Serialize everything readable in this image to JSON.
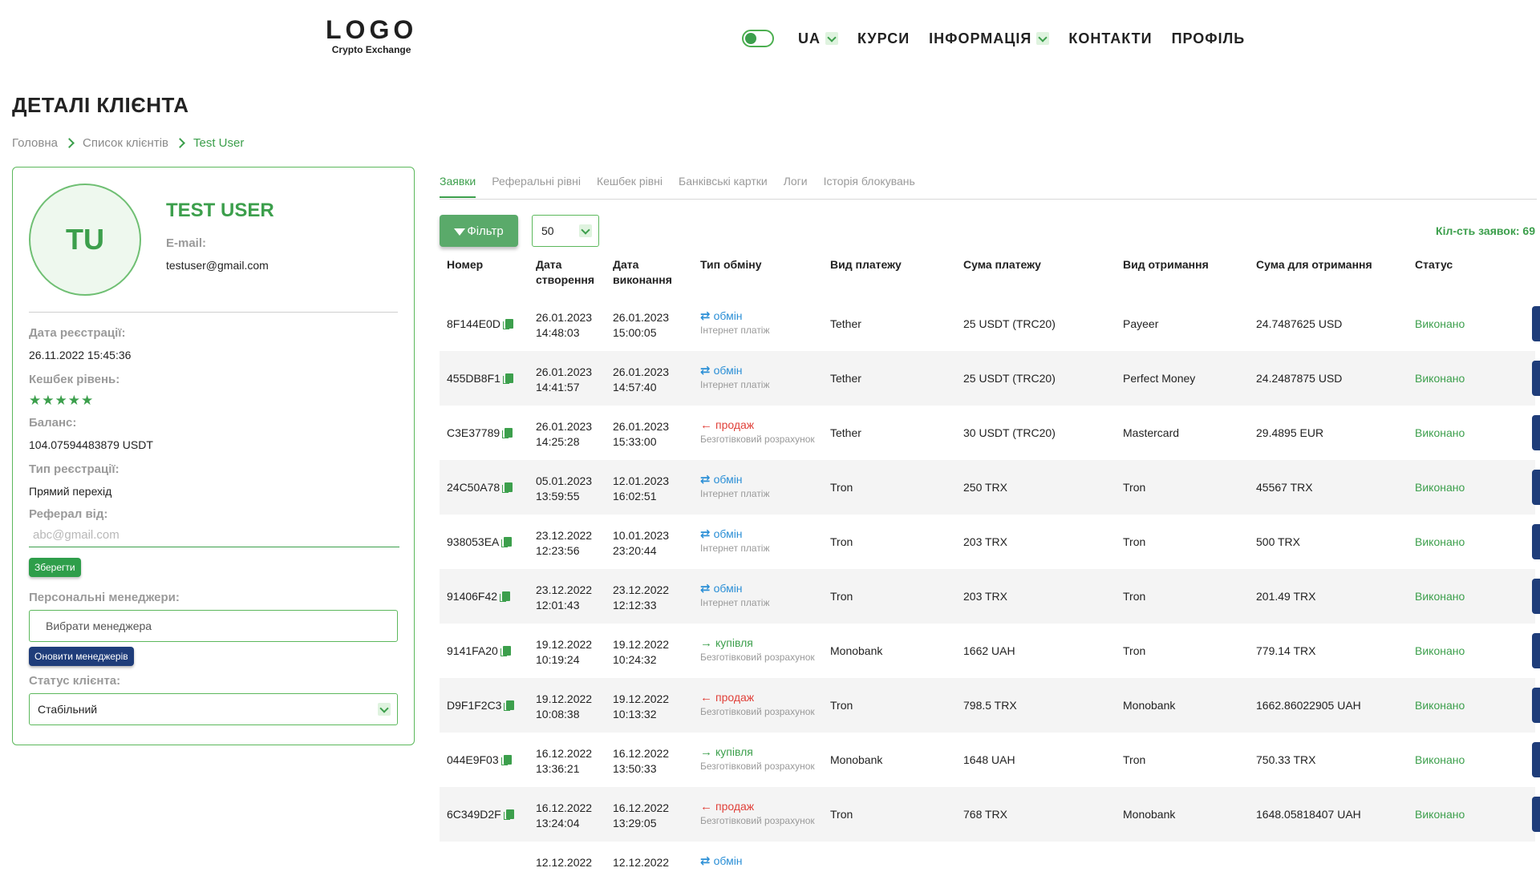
{
  "header": {
    "logo": "LOGO",
    "logo_sub": "Crypto Exchange",
    "lang": "UA",
    "nav": [
      "КУРСИ",
      "ІНФОРМАЦІЯ",
      "КОНТАКТИ",
      "ПРОФІЛЬ"
    ]
  },
  "page": {
    "title": "ДЕТАЛІ КЛІЄНТА",
    "breadcrumb": [
      "Головна",
      "Список клієнтів",
      "Test User"
    ]
  },
  "client": {
    "initials": "TU",
    "name": "TEST USER",
    "email_label": "E-mail:",
    "email": "testuser@gmail.com",
    "reg_date_label": "Дата реєстрації:",
    "reg_date": "26.11.2022 15:45:36",
    "cashback_label": "Кешбек рівень:",
    "cashback_stars": 5,
    "balance_label": "Баланс:",
    "balance": "104.07594483879 USDT",
    "reg_type_label": "Тип реєстрації:",
    "reg_type": "Прямий перехід",
    "referral_label": "Реферал від:",
    "referral_placeholder": "abc@gmail.com",
    "save_button": "Зберегти",
    "managers_label": "Персональні менеджери:",
    "managers_placeholder": "Вибрати менеджера",
    "update_managers_button": "Оновити менеджерів",
    "status_label": "Статус клієнта:",
    "status_value": "Стабільний"
  },
  "tabs": [
    "Заявки",
    "Реферальні рівні",
    "Кешбек рівні",
    "Банківські картки",
    "Логи",
    "Історія блокувань"
  ],
  "toolbar": {
    "filter_label": "Фільтр",
    "per_page": "50",
    "count_label": "Кіл-сть заявок: 69"
  },
  "table": {
    "headers": [
      "Номер",
      "Дата створення",
      "Дата виконання",
      "Тип обміну",
      "Вид платежу",
      "Сума платежу",
      "Вид отримання",
      "Сума для отримання",
      "Статус"
    ],
    "rows": [
      {
        "id": "8F144E0D",
        "created_date": "26.01.2023",
        "created_time": "14:48:03",
        "done_date": "26.01.2023",
        "done_time": "15:00:05",
        "type": "обмін",
        "type_kind": "exchange",
        "subtype": "Інтернет платіж",
        "pay_method": "Tether",
        "pay_amount": "25 USDT (TRC20)",
        "receive_method": "Payeer",
        "receive_amount": "24.7487625 USD",
        "status": "Виконано"
      },
      {
        "id": "455DB8F1",
        "created_date": "26.01.2023",
        "created_time": "14:41:57",
        "done_date": "26.01.2023",
        "done_time": "14:57:40",
        "type": "обмін",
        "type_kind": "exchange",
        "subtype": "Інтернет платіж",
        "pay_method": "Tether",
        "pay_amount": "25 USDT (TRC20)",
        "receive_method": "Perfect Money",
        "receive_amount": "24.2487875 USD",
        "status": "Виконано"
      },
      {
        "id": "C3E37789",
        "created_date": "26.01.2023",
        "created_time": "14:25:28",
        "done_date": "26.01.2023",
        "done_time": "15:33:00",
        "type": "продаж",
        "type_kind": "sell",
        "subtype": "Безготівковий розрахунок",
        "pay_method": "Tether",
        "pay_amount": "30 USDT (TRC20)",
        "receive_method": "Mastercard",
        "receive_amount": "29.4895 EUR",
        "status": "Виконано"
      },
      {
        "id": "24C50A78",
        "created_date": "05.01.2023",
        "created_time": "13:59:55",
        "done_date": "12.01.2023",
        "done_time": "16:02:51",
        "type": "обмін",
        "type_kind": "exchange",
        "subtype": "Інтернет платіж",
        "pay_method": "Tron",
        "pay_amount": "250 TRX",
        "receive_method": "Tron",
        "receive_amount": "45567 TRX",
        "status": "Виконано"
      },
      {
        "id": "938053EA",
        "created_date": "23.12.2022",
        "created_time": "12:23:56",
        "done_date": "10.01.2023",
        "done_time": "23:20:44",
        "type": "обмін",
        "type_kind": "exchange",
        "subtype": "Інтернет платіж",
        "pay_method": "Tron",
        "pay_amount": "203 TRX",
        "receive_method": "Tron",
        "receive_amount": "500 TRX",
        "status": "Виконано"
      },
      {
        "id": "91406F42",
        "created_date": "23.12.2022",
        "created_time": "12:01:43",
        "done_date": "23.12.2022",
        "done_time": "12:12:33",
        "type": "обмін",
        "type_kind": "exchange",
        "subtype": "Інтернет платіж",
        "pay_method": "Tron",
        "pay_amount": "203 TRX",
        "receive_method": "Tron",
        "receive_amount": "201.49 TRX",
        "status": "Виконано"
      },
      {
        "id": "9141FA20",
        "created_date": "19.12.2022",
        "created_time": "10:19:24",
        "done_date": "19.12.2022",
        "done_time": "10:24:32",
        "type": "купівля",
        "type_kind": "buy",
        "subtype": "Безготівковий розрахунок",
        "pay_method": "Monobank",
        "pay_amount": "1662 UAH",
        "receive_method": "Tron",
        "receive_amount": "779.14 TRX",
        "status": "Виконано"
      },
      {
        "id": "D9F1F2C3",
        "created_date": "19.12.2022",
        "created_time": "10:08:38",
        "done_date": "19.12.2022",
        "done_time": "10:13:32",
        "type": "продаж",
        "type_kind": "sell",
        "subtype": "Безготівковий розрахунок",
        "pay_method": "Tron",
        "pay_amount": "798.5 TRX",
        "receive_method": "Monobank",
        "receive_amount": "1662.86022905 UAH",
        "status": "Виконано"
      },
      {
        "id": "044E9F03",
        "created_date": "16.12.2022",
        "created_time": "13:36:21",
        "done_date": "16.12.2022",
        "done_time": "13:50:33",
        "type": "купівля",
        "type_kind": "buy",
        "subtype": "Безготівковий розрахунок",
        "pay_method": "Monobank",
        "pay_amount": "1648 UAH",
        "receive_method": "Tron",
        "receive_amount": "750.33 TRX",
        "status": "Виконано"
      },
      {
        "id": "6C349D2F",
        "created_date": "16.12.2022",
        "created_time": "13:24:04",
        "done_date": "16.12.2022",
        "done_time": "13:29:05",
        "type": "продаж",
        "type_kind": "sell",
        "subtype": "Безготівковий розрахунок",
        "pay_method": "Tron",
        "pay_amount": "768 TRX",
        "receive_method": "Monobank",
        "receive_amount": "1648.05818407 UAH",
        "status": "Виконано"
      },
      {
        "id": "",
        "created_date": "12.12.2022",
        "created_time": "",
        "done_date": "12.12.2022",
        "done_time": "",
        "type": "обмін",
        "type_kind": "exchange",
        "subtype": "",
        "pay_method": "",
        "pay_amount": "",
        "receive_method": "",
        "receive_amount": "",
        "status": ""
      }
    ]
  },
  "colors": {
    "accent": "#3c9f4c",
    "exchange": "#2b8fd6",
    "sell": "#e0413a",
    "buy": "#3c9f4c",
    "dark_button": "#1f3d7a"
  }
}
